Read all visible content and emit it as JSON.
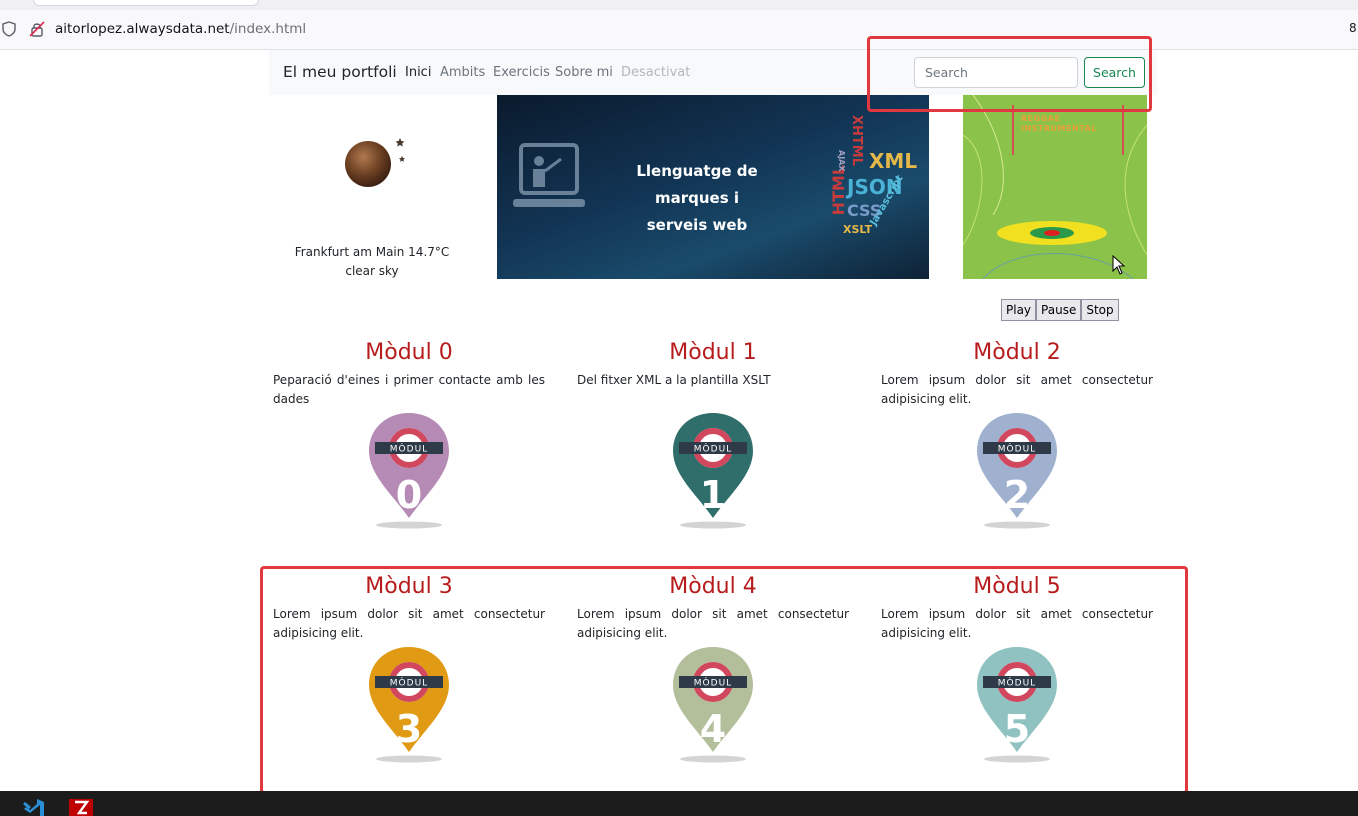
{
  "browser": {
    "url_host": "aitorlopez.alwaysdata.net",
    "url_path": "/index.html",
    "right_edge_text": "8"
  },
  "navbar": {
    "brand": "El meu portfoli",
    "links": [
      "Inici",
      "Ambits",
      "Exercicis",
      "Sobre mi",
      "Desactivat"
    ],
    "search_placeholder": "Search",
    "search_button": "Search"
  },
  "weather": {
    "city_temp": "Frankfurt am Main 14.7°C",
    "description": "clear sky",
    "icon": "moon-night-icon"
  },
  "banner": {
    "title_line1": "Llenguatge de marques i",
    "title_line2": "serveis web",
    "cloud_words": [
      "XML",
      "JSON",
      "XHTML",
      "HTML",
      "CSS",
      "XSLT",
      "Javascript",
      "AJAX"
    ]
  },
  "music": {
    "title_line1": "REGGAE",
    "title_line2": "INSTRUMENTAL"
  },
  "player": {
    "play": "Play",
    "pause": "Pause",
    "stop": "Stop"
  },
  "modules": [
    {
      "title": "Mòdul 0",
      "desc": "Peparació d'eines i primer contacte amb les dades",
      "badge": "MÒDUL",
      "number": "0",
      "color": "#b58ab5"
    },
    {
      "title": "Mòdul 1",
      "desc": "Del fitxer XML a la plantilla XSLT",
      "badge": "MÒDUL",
      "number": "1",
      "color": "#2f6e6a"
    },
    {
      "title": "Mòdul 2",
      "desc": "Lorem ipsum dolor sit amet consectetur adipisicing elit.",
      "badge": "MÒDUL",
      "number": "2",
      "color": "#9fb1cf"
    },
    {
      "title": "Mòdul 3",
      "desc": "Lorem ipsum dolor sit amet consectetur adipisicing elit.",
      "badge": "MÒDUL",
      "number": "3",
      "color": "#e09a14"
    },
    {
      "title": "Mòdul 4",
      "desc": "Lorem ipsum dolor sit amet consectetur adipisicing elit.",
      "badge": "MÒDUL",
      "number": "4",
      "color": "#b3bf9b"
    },
    {
      "title": "Mòdul 5",
      "desc": "Lorem ipsum dolor sit amet consectetur adipisicing elit.",
      "badge": "MÒDUL",
      "number": "5",
      "color": "#8fc2c0"
    }
  ],
  "colors": {
    "module_title": "#b71c1c",
    "search_green": "#198754",
    "annotation_red": "#e0383e"
  }
}
